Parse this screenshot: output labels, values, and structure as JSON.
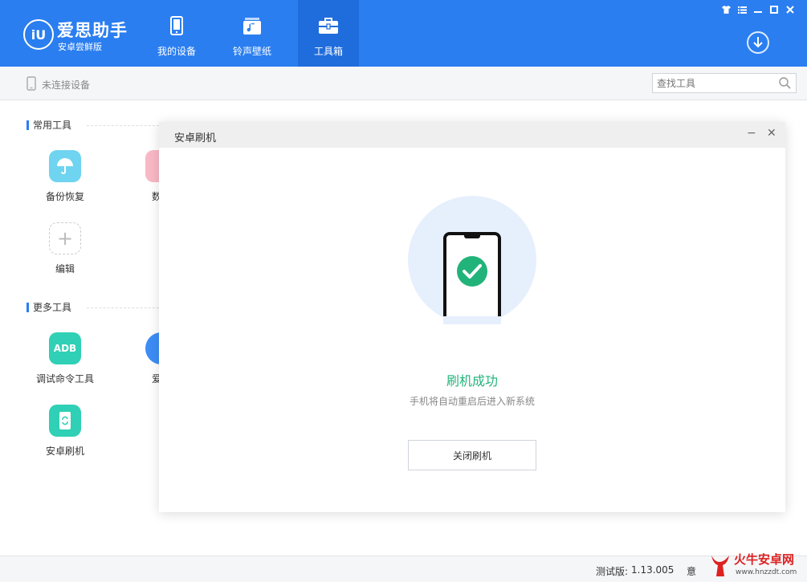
{
  "header": {
    "logo_mark": "iU",
    "logo_title": "爱思助手",
    "logo_subtitle": "安卓尝鲜版",
    "tabs": [
      {
        "label": "我的设备",
        "icon": "phone-icon"
      },
      {
        "label": "铃声壁纸",
        "icon": "music-icon"
      },
      {
        "label": "工具箱",
        "icon": "toolbox-icon",
        "active": true
      }
    ],
    "window_controls": [
      "shirt-icon",
      "list-icon",
      "minimize-icon",
      "maximize-icon",
      "close-icon"
    ],
    "download_icon": "download-icon"
  },
  "toolbar": {
    "device_status": "未连接设备",
    "search_placeholder": "查找工具"
  },
  "sections": {
    "common_title": "常用工具",
    "more_title": "更多工具"
  },
  "tools": {
    "backup": "备份恢复",
    "data_partial": "数据",
    "edit": "编辑",
    "adb_mark": "ADB",
    "adb": "调试命令工具",
    "aisi_partial": "爱思",
    "flash": "安卓刷机"
  },
  "dialog": {
    "title": "安卓刷机",
    "success_title": "刷机成功",
    "success_sub": "手机将自动重启后进入新系统",
    "close_button": "关闭刷机"
  },
  "statusbar": {
    "version_label": "测试版:",
    "version_value": "1.13.005",
    "feedback_partial": "意"
  },
  "watermark": {
    "brand": "火牛安卓网",
    "url": "www.hnzzdt.com"
  },
  "colors": {
    "header_blue": "#2a7ef0",
    "active_tab": "#1f6ddc",
    "success_green": "#22b37a",
    "teal": "#2fd0b5"
  }
}
